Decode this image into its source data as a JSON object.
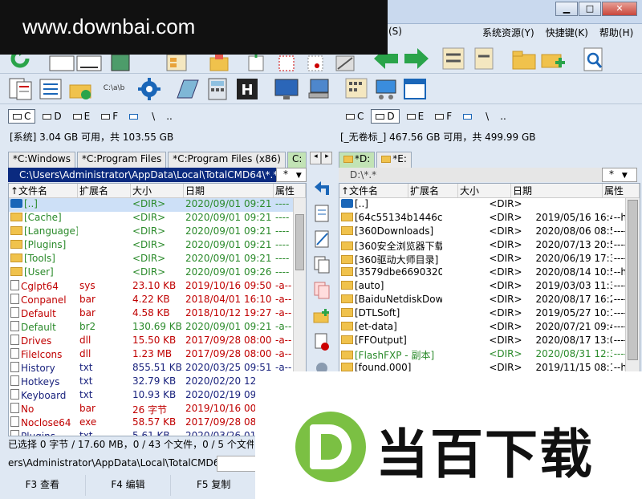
{
  "watermark": "www.downbai.com",
  "menubar": [
    "(S)",
    "系统资源(Y)",
    "快捷键(K)",
    "帮助(H)"
  ],
  "window_buttons": {
    "minimize": "▁",
    "maximize": "□",
    "close": "✕"
  },
  "left": {
    "drives": [
      "C",
      "D",
      "E",
      "F",
      "\\",
      ".."
    ],
    "active_drive": "C",
    "space_info": "[系统]  3.04 GB 可用，共 103.55 GB",
    "tabs": [
      "*C:Windows",
      "*C:Program Files",
      "*C:Program Files (x86)",
      "C:"
    ],
    "path": "C:\\Users\\Administrator\\AppData\\Local\\TotalCMD64\\*.*",
    "filter": "*",
    "headers": [
      "↑文件名",
      "扩展名",
      "大小",
      "日期",
      "属性"
    ],
    "rows": [
      {
        "icon": "up",
        "name": "[..]",
        "ext": "",
        "size": "<DIR>",
        "date": "2020/09/01 09:21",
        "attr": "----",
        "color": "#2a8a2a",
        "selected": true
      },
      {
        "icon": "folder",
        "name": "[Cache]",
        "ext": "",
        "size": "<DIR>",
        "date": "2020/09/01 09:21",
        "attr": "----",
        "color": "#2a8a2a"
      },
      {
        "icon": "folder",
        "name": "[Language]",
        "ext": "",
        "size": "<DIR>",
        "date": "2020/09/01 09:21",
        "attr": "----",
        "color": "#2a8a2a"
      },
      {
        "icon": "folder",
        "name": "[Plugins]",
        "ext": "",
        "size": "<DIR>",
        "date": "2020/09/01 09:21",
        "attr": "----",
        "color": "#2a8a2a"
      },
      {
        "icon": "folder",
        "name": "[Tools]",
        "ext": "",
        "size": "<DIR>",
        "date": "2020/09/01 09:21",
        "attr": "----",
        "color": "#2a8a2a"
      },
      {
        "icon": "folder",
        "name": "[User]",
        "ext": "",
        "size": "<DIR>",
        "date": "2020/09/01 09:26",
        "attr": "----",
        "color": "#2a8a2a"
      },
      {
        "icon": "doc",
        "name": "Cglpt64",
        "ext": "sys",
        "size": "23.10 KB",
        "date": "2019/10/16 09:50",
        "attr": "-a--",
        "color": "#c00000"
      },
      {
        "icon": "doc",
        "name": "Conpanel",
        "ext": "bar",
        "size": "4.22 KB",
        "date": "2018/04/01 16:10",
        "attr": "-a--",
        "color": "#c00000"
      },
      {
        "icon": "doc",
        "name": "Default",
        "ext": "bar",
        "size": "4.58 KB",
        "date": "2018/10/12 19:27",
        "attr": "-a--",
        "color": "#c00000"
      },
      {
        "icon": "doc",
        "name": "Default",
        "ext": "br2",
        "size": "130.69 KB",
        "date": "2020/09/01 09:21",
        "attr": "-a--",
        "color": "#2a8a2a"
      },
      {
        "icon": "doc",
        "name": "Drives",
        "ext": "dll",
        "size": "15.50 KB",
        "date": "2017/09/28 08:00",
        "attr": "-a--",
        "color": "#c00000"
      },
      {
        "icon": "doc",
        "name": "FileIcons",
        "ext": "dll",
        "size": "1.23 MB",
        "date": "2017/09/28 08:00",
        "attr": "-a--",
        "color": "#c00000"
      },
      {
        "icon": "doc",
        "name": "History",
        "ext": "txt",
        "size": "855.51 KB",
        "date": "2020/03/25 09:51",
        "attr": "-a--",
        "color": "#1a237e"
      },
      {
        "icon": "doc",
        "name": "Hotkeys",
        "ext": "txt",
        "size": "32.79 KB",
        "date": "2020/02/20 12:",
        "attr": "",
        "color": "#1a237e"
      },
      {
        "icon": "doc",
        "name": "Keyboard",
        "ext": "txt",
        "size": "10.93 KB",
        "date": "2020/02/19 09:",
        "attr": "",
        "color": "#1a237e"
      },
      {
        "icon": "doc",
        "name": "No",
        "ext": "bar",
        "size": "26 字节",
        "date": "2019/10/16 00:",
        "attr": "",
        "color": "#c00000"
      },
      {
        "icon": "doc",
        "name": "Noclose64",
        "ext": "exe",
        "size": "58.57 KB",
        "date": "2017/09/28 08:",
        "attr": "",
        "color": "#c00000"
      },
      {
        "icon": "doc",
        "name": "Plugins",
        "ext": "txt",
        "size": "5.61 KB",
        "date": "2020/03/26 01:",
        "attr": "",
        "color": "#1a237e"
      }
    ],
    "status": "已选择 0 字节 / 17.60 MB，0 / 43 个文件，0 / 5 个文件"
  },
  "right": {
    "drives": [
      "C",
      "D",
      "E",
      "F",
      "\\",
      ".."
    ],
    "active_drive": "D",
    "space_info": "[_无卷标_]  467.56 GB 可用，共 499.99 GB",
    "tabs": [
      "*D:",
      "*E:"
    ],
    "path": "D:\\*.*",
    "filter": "*",
    "headers": [
      "↑文件名",
      "扩展名",
      "大小",
      "日期",
      "属性"
    ],
    "rows": [
      {
        "icon": "up",
        "name": "[..]",
        "ext": "",
        "size": "<DIR>",
        "date": "",
        "attr": "",
        "color": "#000000"
      },
      {
        "icon": "folder",
        "name": "[64c55134b1446c2c..]",
        "ext": "",
        "size": "<DIR>",
        "date": "2019/05/16 16:41",
        "attr": "--h-",
        "color": "#000000"
      },
      {
        "icon": "folder",
        "name": "[360Downloads]",
        "ext": "",
        "size": "<DIR>",
        "date": "2020/08/06 08:59",
        "attr": "----",
        "color": "#000000"
      },
      {
        "icon": "folder",
        "name": "[360安全浏览器下载]",
        "ext": "",
        "size": "<DIR>",
        "date": "2020/07/13 20:51",
        "attr": "----",
        "color": "#000000"
      },
      {
        "icon": "folder",
        "name": "[360驱动大师目录]",
        "ext": "",
        "size": "<DIR>",
        "date": "2020/06/19 17:30",
        "attr": "----",
        "color": "#000000"
      },
      {
        "icon": "folder",
        "name": "[3579dbe66903204..]",
        "ext": "",
        "size": "<DIR>",
        "date": "2020/08/14 10:52",
        "attr": "--h-",
        "color": "#000000"
      },
      {
        "icon": "folder",
        "name": "[auto]",
        "ext": "",
        "size": "<DIR>",
        "date": "2019/03/03 11:32",
        "attr": "----",
        "color": "#000000"
      },
      {
        "icon": "folder",
        "name": "[BaiduNetdiskDownlo..]",
        "ext": "",
        "size": "<DIR>",
        "date": "2020/08/17 16:21",
        "attr": "----",
        "color": "#000000"
      },
      {
        "icon": "folder",
        "name": "[DTLSoft]",
        "ext": "",
        "size": "<DIR>",
        "date": "2019/05/27 10:13",
        "attr": "----",
        "color": "#000000"
      },
      {
        "icon": "folder",
        "name": "[et-data]",
        "ext": "",
        "size": "<DIR>",
        "date": "2020/07/21 09:44",
        "attr": "----",
        "color": "#000000"
      },
      {
        "icon": "folder",
        "name": "[FFOutput]",
        "ext": "",
        "size": "<DIR>",
        "date": "2020/08/17 13:00",
        "attr": "----",
        "color": "#000000"
      },
      {
        "icon": "folder",
        "name": "[FlashFXP - 副本]",
        "ext": "",
        "size": "<DIR>",
        "date": "2020/08/31 12:32",
        "attr": "----",
        "color": "#2a8a2a"
      },
      {
        "icon": "folder",
        "name": "[found.000]",
        "ext": "",
        "size": "<DIR>",
        "date": "2019/11/15 08:19",
        "attr": "--hs",
        "color": "#000000"
      }
    ]
  },
  "cmdline": "ers\\Administrator\\AppData\\Local\\TotalCMD64>",
  "fkeys": [
    "F3 查看",
    "F4 编辑",
    "F5 复制"
  ],
  "logo_text": "当百下载",
  "toolbar_path_label": "C:\\a\\b"
}
